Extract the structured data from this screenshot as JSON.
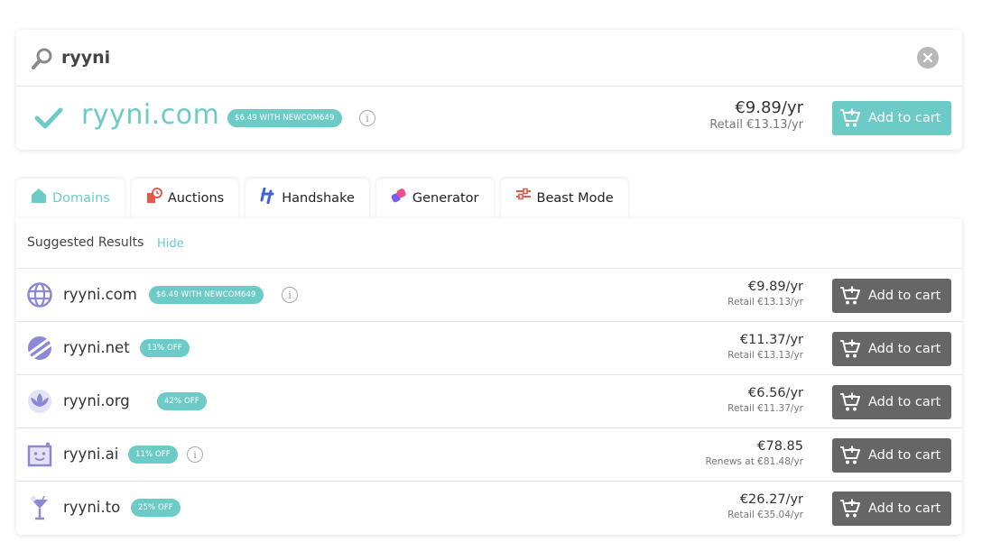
{
  "search": {
    "query": "ryyni"
  },
  "featured": {
    "domain": "ryyni.com",
    "badge": "$6.49 WITH NEWCOM649",
    "price": "€9.89/yr",
    "retail": "Retail €13.13/yr",
    "button": "Add to cart"
  },
  "tabs": [
    {
      "label": "Domains",
      "icon": "house-icon"
    },
    {
      "label": "Auctions",
      "icon": "auction-icon"
    },
    {
      "label": "Handshake",
      "icon": "handshake-icon"
    },
    {
      "label": "Generator",
      "icon": "generator-icon"
    },
    {
      "label": "Beast Mode",
      "icon": "sliders-icon"
    }
  ],
  "suggested": {
    "title": "Suggested Results",
    "hide": "Hide",
    "rows": [
      {
        "domain": "ryyni.com",
        "badge": "$6.49 WITH NEWCOM649",
        "price": "€9.89/yr",
        "sub": "Retail €13.13/yr",
        "button": "Add to cart",
        "icon": "globe-icon"
      },
      {
        "domain": "ryyni.net",
        "badge": "13% OFF",
        "price": "€11.37/yr",
        "sub": "Retail €13.13/yr",
        "button": "Add to cart",
        "icon": "net-planet-icon"
      },
      {
        "domain": "ryyni.org",
        "badge": "42% OFF",
        "price": "€6.56/yr",
        "sub": "Retail €11.37/yr",
        "button": "Add to cart",
        "icon": "lotus-icon"
      },
      {
        "domain": "ryyni.ai",
        "badge": "11% OFF",
        "price": "€78.85",
        "sub": "Renews at €81.48/yr",
        "button": "Add to cart",
        "icon": "robot-icon"
      },
      {
        "domain": "ryyni.to",
        "badge": "25% OFF",
        "price": "€26.27/yr",
        "sub": "Retail €35.04/yr",
        "button": "Add to cart",
        "icon": "cocktail-icon"
      }
    ]
  },
  "colors": {
    "accent": "#6ccbc6",
    "dark_button": "#666666",
    "icon_purple": "#8c88d6"
  }
}
